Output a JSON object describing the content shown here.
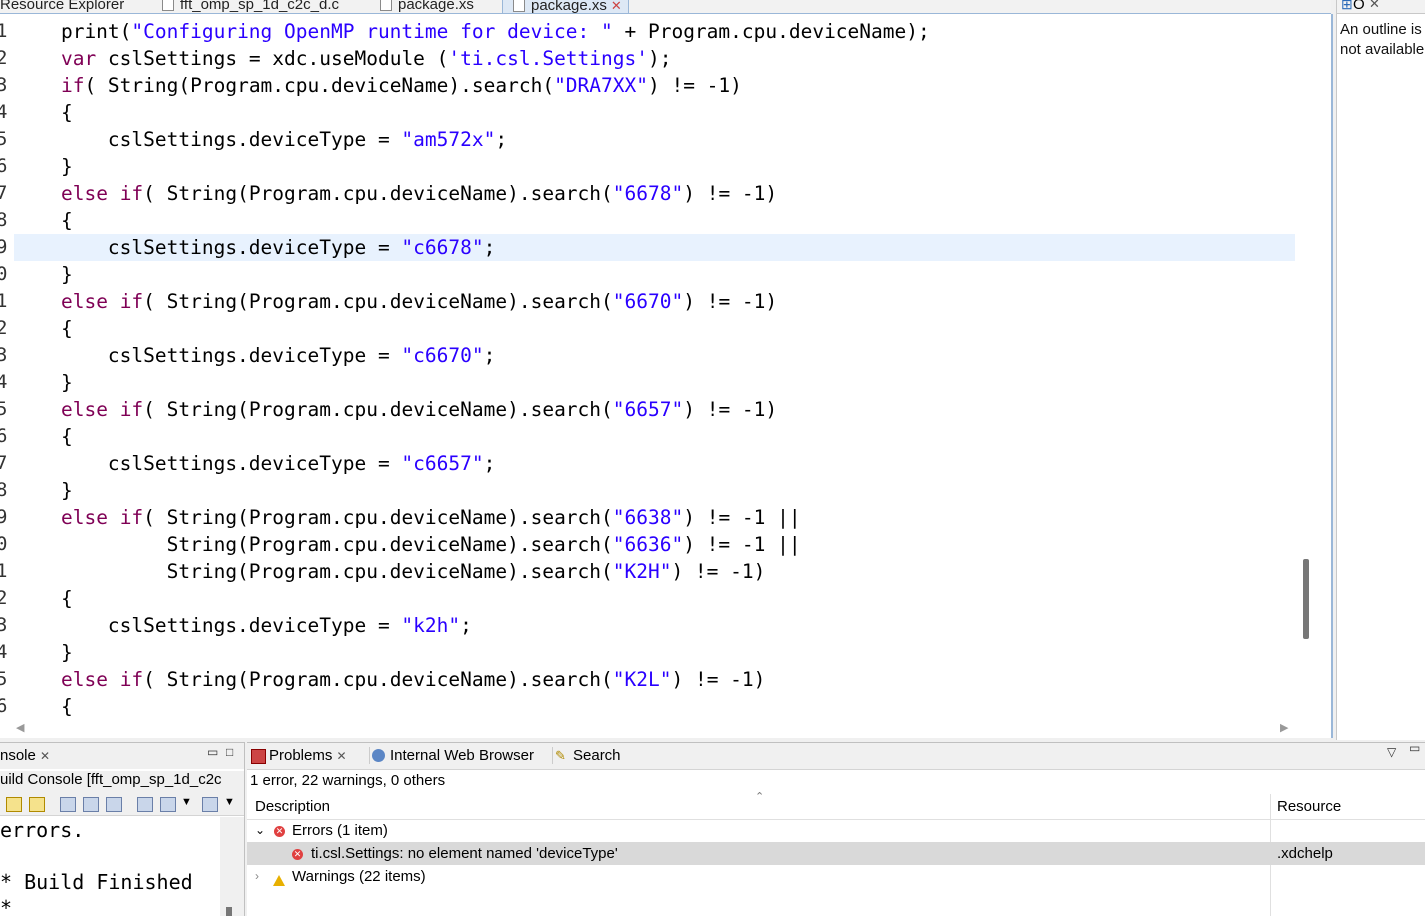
{
  "tabs": [
    {
      "label": "Resource Explorer",
      "active": false,
      "icon": "globe-icon"
    },
    {
      "label": "fft_omp_sp_1d_c2c_d.c",
      "active": false,
      "icon": "c-file-icon"
    },
    {
      "label": "package.xs",
      "active": false,
      "icon": "xs-file-icon"
    },
    {
      "label": "package.xs",
      "active": true,
      "icon": "xs-file-icon"
    }
  ],
  "editor": {
    "line_numbers": [
      "1",
      "2",
      "3",
      "4",
      "5",
      "6",
      "7",
      "8",
      "9",
      "0",
      "1",
      "2",
      "3",
      "4",
      "5",
      "6",
      "7",
      "8",
      "9",
      "0",
      "1",
      "2",
      "3",
      "4",
      "5",
      "6"
    ],
    "highlighted_line": 9,
    "lines": [
      "print(\"Configuring OpenMP runtime for device: \" + Program.cpu.deviceName);",
      "var cslSettings = xdc.useModule ('ti.csl.Settings');",
      "if( String(Program.cpu.deviceName).search(\"DRA7XX\") != -1)",
      "{",
      "    cslSettings.deviceType = \"am572x\";",
      "}",
      "else if( String(Program.cpu.deviceName).search(\"6678\") != -1)",
      "{",
      "    cslSettings.deviceType = \"c6678\";",
      "}",
      "else if( String(Program.cpu.deviceName).search(\"6670\") != -1)",
      "{",
      "    cslSettings.deviceType = \"c6670\";",
      "}",
      "else if( String(Program.cpu.deviceName).search(\"6657\") != -1)",
      "{",
      "    cslSettings.deviceType = \"c6657\";",
      "}",
      "else if( String(Program.cpu.deviceName).search(\"6638\") != -1 ||",
      "         String(Program.cpu.deviceName).search(\"6636\") != -1 ||",
      "         String(Program.cpu.deviceName).search(\"K2H\") != -1)",
      "{",
      "    cslSettings.deviceType = \"k2h\";",
      "}",
      "else if( String(Program.cpu.deviceName).search(\"K2L\") != -1)",
      "{"
    ]
  },
  "outline": {
    "tab_label": "O",
    "message": "An outline is not available."
  },
  "console": {
    "tab_label": "nsole",
    "subtitle": "uild Console [fft_omp_sp_1d_c2c",
    "output": [
      "errors.",
      "",
      "* Build Finished",
      "*"
    ]
  },
  "problems": {
    "tabs": [
      {
        "label": "Problems",
        "icon": "problems-icon"
      },
      {
        "label": "Internal Web Browser",
        "icon": "globe-icon"
      },
      {
        "label": "Search",
        "icon": "search-icon"
      }
    ],
    "summary": "1 error, 22 warnings, 0 others",
    "col_description": "Description",
    "col_resource": "Resource",
    "errors_group": "Errors (1 item)",
    "error_item": "ti.csl.Settings: no element named 'deviceType'",
    "error_resource": ".xdchelp",
    "warnings_group": "Warnings (22 items)"
  },
  "colors": {
    "keyword": "#7f0055",
    "string": "#2a00ff",
    "current_line": "#e8f2fe",
    "active_tab": "#dde8f5"
  }
}
